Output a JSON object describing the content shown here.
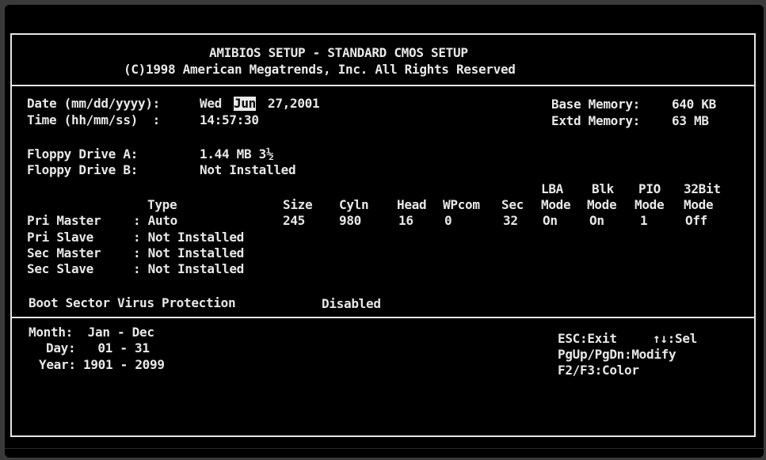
{
  "header": {
    "title": "AMIBIOS SETUP - STANDARD CMOS SETUP",
    "copyright": "(C)1998 American Megatrends, Inc. All Rights Reserved"
  },
  "datetime": {
    "date_label": "Date (mm/dd/yyyy):",
    "date_weekday": "Wed",
    "date_month": "Jun",
    "date_rest": "27,2001",
    "time_label": "Time (hh/mm/ss)  :",
    "time_value": "14:57:30"
  },
  "memory": {
    "base_label": "Base Memory:",
    "base_value": "640 KB",
    "extd_label": "Extd Memory:",
    "extd_value": "63 MB"
  },
  "floppy": {
    "a_label": "Floppy Drive A:",
    "a_value": "1.44 MB 3½",
    "b_label": "Floppy Drive B:",
    "b_value": "Not Installed"
  },
  "ide": {
    "headers": {
      "type": "Type",
      "size": "Size",
      "cyln": "Cyln",
      "head": "Head",
      "wpcom": "WPcom",
      "sec": "Sec",
      "lba_1": "LBA",
      "lba_2": "Mode",
      "blk_1": "Blk",
      "blk_2": "Mode",
      "pio_1": "PIO",
      "pio_2": "Mode",
      "bit32_1": "32Bit",
      "bit32_2": "Mode"
    },
    "pri_master": {
      "label": "Pri Master",
      "type": ": Auto",
      "size": "245",
      "cyln": "980",
      "head": "16",
      "wpcom": "0",
      "sec": "32",
      "lba": "On",
      "blk": "On",
      "pio": "1",
      "bit32": "Off"
    },
    "pri_slave": {
      "label": "Pri Slave",
      "type": ": Not Installed"
    },
    "sec_master": {
      "label": "Sec Master",
      "type": ": Not Installed"
    },
    "sec_slave": {
      "label": "Sec Slave",
      "type": ": Not Installed"
    }
  },
  "virus": {
    "label": "Boot Sector Virus Protection",
    "value": "Disabled"
  },
  "help": {
    "month": "Month:  Jan - Dec",
    "day": "Day:   01 - 31",
    "year": "Year: 1901 - 2099"
  },
  "keys": {
    "esc": "ESC:Exit",
    "sel": "↑↓:Sel",
    "pg": "PgUp/PgDn:Modify",
    "color": "F2/F3:Color"
  },
  "colors": {
    "text": "#e8e8e8",
    "background": "#000000",
    "frame": "#e6e6e6"
  }
}
